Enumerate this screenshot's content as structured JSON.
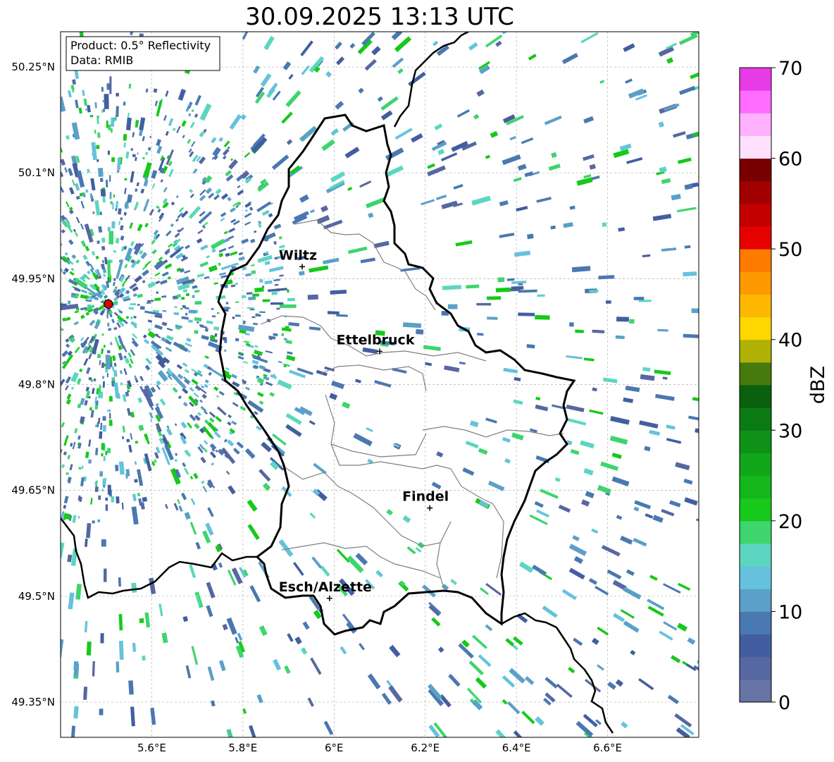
{
  "title": "30.09.2025 13:13 UTC",
  "info": {
    "product": "Product: 0.5° Reflectivity",
    "data_source": "Data: RMIB"
  },
  "axes": {
    "x_ticks": [
      "5.6°E",
      "5.8°E",
      "6°E",
      "6.2°E",
      "6.4°E",
      "6.6°E"
    ],
    "x_values": [
      5.6,
      5.8,
      6.0,
      6.2,
      6.4,
      6.6
    ],
    "y_ticks": [
      "50.25°N",
      "50.1°N",
      "49.95°N",
      "49.8°N",
      "49.65°N",
      "49.5°N",
      "49.35°N"
    ],
    "y_values": [
      50.25,
      50.1,
      49.95,
      49.8,
      49.65,
      49.5,
      49.35
    ],
    "lon_range": [
      5.4,
      6.8
    ],
    "lat_range": [
      49.3,
      50.3
    ],
    "gridlines": true
  },
  "cities": [
    {
      "name": "Wiltz",
      "lon": 5.93,
      "lat": 49.967
    },
    {
      "name": "Ettelbruck",
      "lon": 6.1,
      "lat": 49.847
    },
    {
      "name": "Findel",
      "lon": 6.21,
      "lat": 49.625
    },
    {
      "name": "Esch/Alzette",
      "lon": 5.99,
      "lat": 49.497
    }
  ],
  "radar_site": {
    "lon": 5.505,
    "lat": 49.914
  },
  "colorbar": {
    "label": "dBZ",
    "min": 0,
    "max": 70,
    "tick_labels": [
      "0",
      "10",
      "20",
      "30",
      "40",
      "50",
      "60",
      "70"
    ],
    "tick_values": [
      0,
      10,
      20,
      30,
      40,
      50,
      60,
      70
    ],
    "colors": [
      "#6674a6",
      "#5667a1",
      "#435ea0",
      "#4a78b0",
      "#5aa0c8",
      "#66c2dc",
      "#5cd6c0",
      "#3dd56c",
      "#16c91a",
      "#13b71b",
      "#12a61b",
      "#0f9118",
      "#0c7a13",
      "#0a600f",
      "#467a0d",
      "#b0b006",
      "#fed700",
      "#feb801",
      "#fe9a00",
      "#fe7b00",
      "#e60000",
      "#c30000",
      "#a20000",
      "#780000",
      "#ffe0ff",
      "#ffb0ff",
      "#ff6cff",
      "#e83be8"
    ]
  }
}
